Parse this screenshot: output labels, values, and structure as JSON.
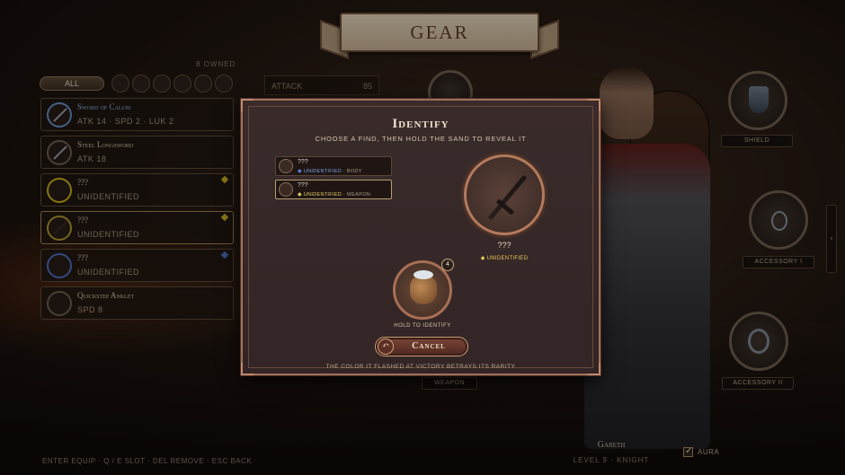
{
  "header": {
    "title": "GEAR"
  },
  "inventory": {
    "owned_label": "8 OWNED",
    "filter_all": "ALL",
    "items": [
      {
        "name": "Sword of Calum",
        "stats": "ATK 14 · SPD 2 · LUK 2",
        "rarity_color": "#6a8fc9",
        "gem": ""
      },
      {
        "name": "Steel Longsword",
        "stats": "ATK 18",
        "rarity_color": "#6f6051",
        "gem": ""
      },
      {
        "name": "???",
        "stats": "UNIDENTIFIED",
        "rarity_color": "#c9b21e",
        "gem": "#c9b21e"
      },
      {
        "name": "???",
        "stats": "UNIDENTIFIED",
        "rarity_color": "#b09a2a",
        "gem": "#c9b21e"
      },
      {
        "name": "???",
        "stats": "UNIDENTIFIED",
        "rarity_color": "#4e6fc2",
        "gem": "#4e6fc2"
      },
      {
        "name": "Quickstep Anklet",
        "stats": "SPD 8",
        "rarity_color": "#6f6051",
        "gem": ""
      }
    ]
  },
  "stat_panel": {
    "label": "ATTACK",
    "value": "85"
  },
  "slots": {
    "shield": "SHIELD",
    "accessory1": "ACCESSORY I",
    "accessory2": "ACCESSORY II",
    "weapon": "WEAPON"
  },
  "character": {
    "name": "Gareth",
    "level": "LEVEL 9 · KNIGHT",
    "aura_label": "AURA"
  },
  "hints": "ENTER EQUIP · Q / E SLOT · DEL REMOVE · ESC BACK",
  "modal": {
    "title": "Identify",
    "subtitle": "CHOOSE A FIND, THEN HOLD THE SAND TO REVEAL IT",
    "finds": [
      {
        "name": "???",
        "status": "UNIDENTIFIED",
        "type": "BODY",
        "dot_color": "#5f7fd1"
      },
      {
        "name": "???",
        "status": "UNIDENTIFIED",
        "type": "WEAPON",
        "dot_color": "#e5c85a"
      }
    ],
    "preview": {
      "name": "???",
      "status": "UNIDENTIFIED"
    },
    "sand_count": "4",
    "hold_label": "HOLD TO IDENTIFY",
    "cancel_label": "Cancel",
    "note": "THE COLOR IT FLASHED AT VICTORY BETRAYS ITS RARITY"
  }
}
